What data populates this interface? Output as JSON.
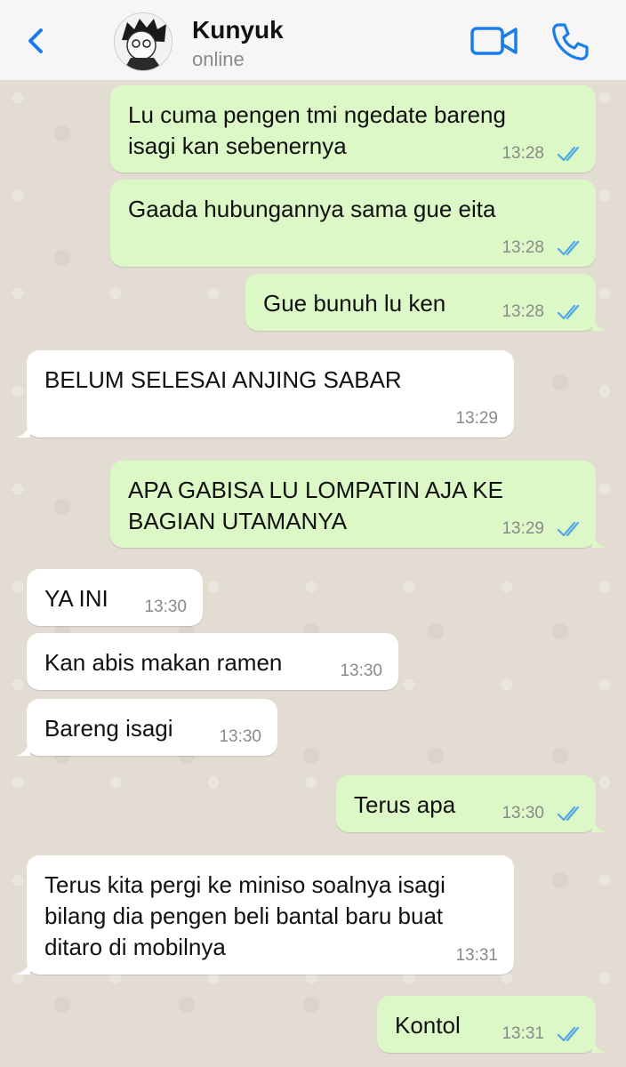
{
  "header": {
    "contact_name": "Kunyuk",
    "status": "online"
  },
  "colors": {
    "accent": "#1a7ee8",
    "outgoing_bubble": "#dcf8c6",
    "incoming_bubble": "#ffffff",
    "read_ticks": "#4fa7e8",
    "wallpaper": "#e3dcd3"
  },
  "messages": [
    {
      "direction": "out",
      "text": "Lu cuma pengen tmi ngedate bareng\nisagi kan sebenernya",
      "time": "13:28",
      "status": "read"
    },
    {
      "direction": "out",
      "text": "Gaada hubungannya sama gue eita",
      "time": "13:28",
      "status": "read"
    },
    {
      "direction": "out",
      "text": "Gue bunuh lu ken",
      "time": "13:28",
      "status": "read"
    },
    {
      "direction": "in",
      "text": "BELUM SELESAI ANJING SABAR",
      "time": "13:29"
    },
    {
      "direction": "out",
      "text": "APA GABISA LU LOMPATIN AJA KE\nBAGIAN UTAMANYA",
      "time": "13:29",
      "status": "read"
    },
    {
      "direction": "in",
      "text": "YA INI",
      "time": "13:30"
    },
    {
      "direction": "in",
      "text": "Kan abis makan ramen",
      "time": "13:30"
    },
    {
      "direction": "in",
      "text": "Bareng isagi",
      "time": "13:30"
    },
    {
      "direction": "out",
      "text": "Terus apa",
      "time": "13:30",
      "status": "read"
    },
    {
      "direction": "in",
      "text": "Terus kita pergi ke miniso soalnya isagi\nbilang dia pengen beli bantal baru buat\nditaro di mobilnya",
      "time": "13:31"
    },
    {
      "direction": "out",
      "text": "Kontol",
      "time": "13:31",
      "status": "read"
    }
  ],
  "icons": {
    "back": "chevron-left-icon",
    "video": "video-camera-icon",
    "call": "phone-icon",
    "read_status": "double-check-icon"
  }
}
